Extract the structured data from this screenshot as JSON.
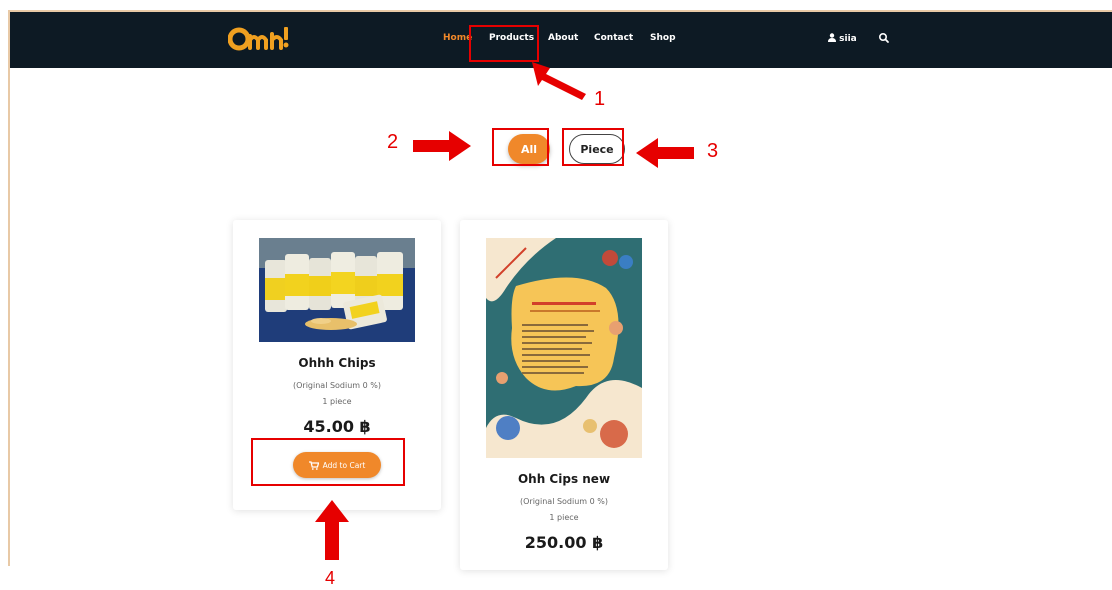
{
  "header": {
    "logo_text": "Ohh!",
    "nav": [
      "Home",
      "Products",
      "About",
      "Contact",
      "Shop"
    ],
    "active": "Home",
    "user": "siia"
  },
  "filters": {
    "all": "All",
    "piece": "Piece"
  },
  "products": [
    {
      "name": "Ohhh Chips",
      "desc": "(Original Sodium 0 %)",
      "unit": "1 piece",
      "price": "45.00 ฿",
      "add_to_cart": "Add to Cart"
    },
    {
      "name": "Ohh Cips new",
      "desc": "(Original Sodium 0 %)",
      "unit": "1 piece",
      "price": "250.00 ฿"
    }
  ],
  "annotations": [
    "1",
    "2",
    "3",
    "4"
  ],
  "colors": {
    "nav_bg": "#0d1a24",
    "accent": "#f0882a",
    "annotation": "#e60000"
  }
}
